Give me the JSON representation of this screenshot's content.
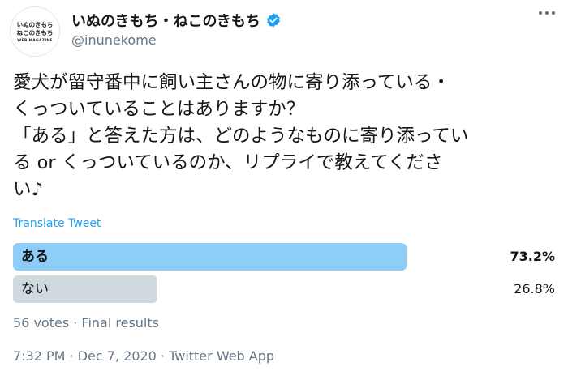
{
  "account": {
    "avatar_lines": [
      "いぬのきもち",
      "ねこのきもち",
      "WEB MAGAZINE"
    ],
    "display_name": "いぬのきもち・ねこのきもち",
    "handle": "@inunekome",
    "verified": true
  },
  "tweet": {
    "text": "愛犬が留守番中に飼い主さんの物に寄り添っている・\nくっついていることはありますか？\n「ある」と答えた方は、どのようなものに寄り添ってい\nる or くっついているのか、リプライで教えてくださ\nい♪",
    "translate_label": "Translate Tweet"
  },
  "poll": {
    "options": [
      {
        "label": "ある",
        "percent_text": "73.2%",
        "percent": 73.2,
        "winner": true
      },
      {
        "label": "ない",
        "percent_text": "26.8%",
        "percent": 26.8,
        "winner": false
      }
    ],
    "meta": "56 votes · Final results"
  },
  "footer": {
    "timestamp": "7:32 PM · Dec 7, 2020 · Twitter Web App"
  },
  "colors": {
    "accent": "#1da1f2",
    "winner_bar": "#8ecdf7",
    "loser_bar": "#cfd9de",
    "secondary_text": "#657786"
  },
  "icons": [
    "verified-badge-icon",
    "more-options-icon"
  ]
}
